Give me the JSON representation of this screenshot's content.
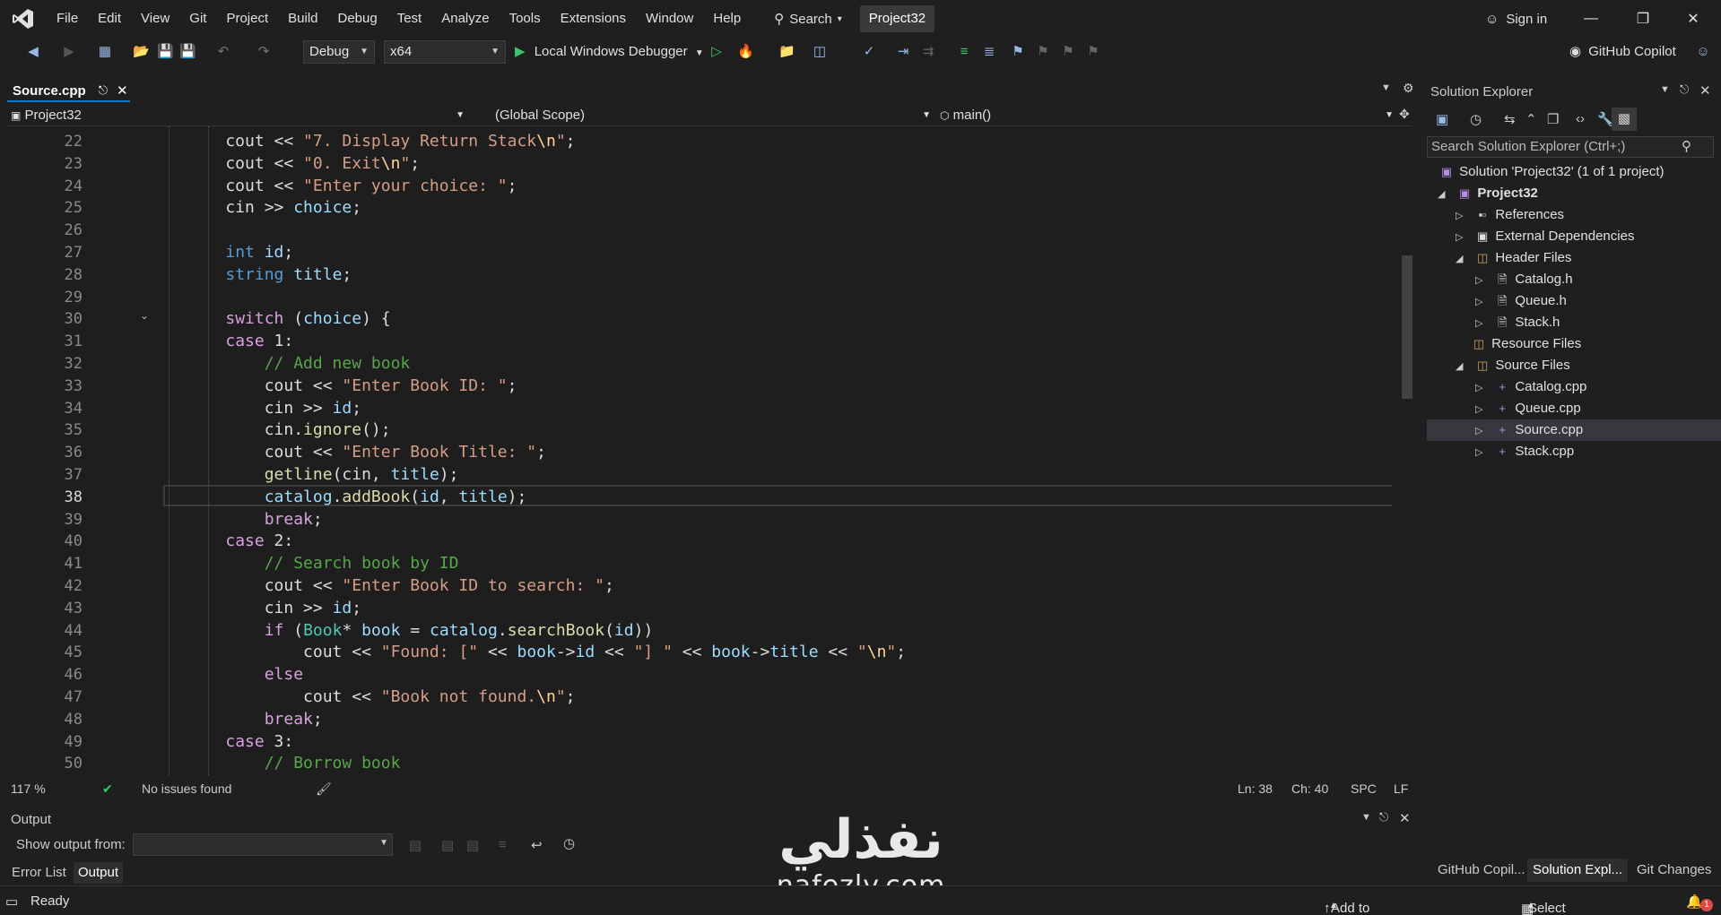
{
  "menu": {
    "items": [
      "File",
      "Edit",
      "View",
      "Git",
      "Project",
      "Build",
      "Debug",
      "Test",
      "Analyze",
      "Tools",
      "Extensions",
      "Window",
      "Help"
    ],
    "search_label": "Search",
    "project_badge": "Project32",
    "signin_label": "Sign in"
  },
  "toolbar": {
    "config": "Debug",
    "platform": "x64",
    "debugger": "Local Windows Debugger",
    "copilot_label": "GitHub Copilot"
  },
  "tab": {
    "active_label": "Source.cpp"
  },
  "navbar": {
    "project": "Project32",
    "scope": "(Global Scope)",
    "member": "main()"
  },
  "editor": {
    "current_line": 38,
    "lines": [
      {
        "n": "22",
        "code": "    cout << \"7. Display Return Stack\\n\";"
      },
      {
        "n": "23",
        "code": "    cout << \"0. Exit\\n\";"
      },
      {
        "n": "24",
        "code": "    cout << \"Enter your choice: \";"
      },
      {
        "n": "25",
        "code": "    cin >> choice;"
      },
      {
        "n": "26",
        "code": ""
      },
      {
        "n": "27",
        "code": "    int id;"
      },
      {
        "n": "28",
        "code": "    string title;"
      },
      {
        "n": "29",
        "code": ""
      },
      {
        "n": "30",
        "code": "    switch (choice) {"
      },
      {
        "n": "31",
        "code": "    case 1:"
      },
      {
        "n": "32",
        "code": "        // Add new book"
      },
      {
        "n": "33",
        "code": "        cout << \"Enter Book ID: \";"
      },
      {
        "n": "34",
        "code": "        cin >> id;"
      },
      {
        "n": "35",
        "code": "        cin.ignore();"
      },
      {
        "n": "36",
        "code": "        cout << \"Enter Book Title: \";"
      },
      {
        "n": "37",
        "code": "        getline(cin, title);"
      },
      {
        "n": "38",
        "code": "        catalog.addBook(id, title);"
      },
      {
        "n": "39",
        "code": "        break;"
      },
      {
        "n": "40",
        "code": "    case 2:"
      },
      {
        "n": "41",
        "code": "        // Search book by ID"
      },
      {
        "n": "42",
        "code": "        cout << \"Enter Book ID to search: \";"
      },
      {
        "n": "43",
        "code": "        cin >> id;"
      },
      {
        "n": "44",
        "code": "        if (Book* book = catalog.searchBook(id))"
      },
      {
        "n": "45",
        "code": "            cout << \"Found: [\" << book->id << \"] \" << book->title << \"\\n\";"
      },
      {
        "n": "46",
        "code": "        else"
      },
      {
        "n": "47",
        "code": "            cout << \"Book not found.\\n\";"
      },
      {
        "n": "48",
        "code": "        break;"
      },
      {
        "n": "49",
        "code": "    case 3:"
      },
      {
        "n": "50",
        "code": "        // Borrow book"
      }
    ]
  },
  "editor_status": {
    "zoom": "117 %",
    "issues": "No issues found",
    "line": "Ln: 38",
    "col": "Ch: 40",
    "spacing": "SPC",
    "eol": "LF"
  },
  "output": {
    "title": "Output",
    "show_from_label": "Show output from:",
    "tabs": [
      "Error List",
      "Output"
    ]
  },
  "solution_explorer": {
    "title": "Solution Explorer",
    "search_placeholder": "Search Solution Explorer (Ctrl+;)",
    "tree": [
      {
        "label": "Solution 'Project32' (1 of 1 project)",
        "icon": "solution-icon"
      },
      {
        "label": "Project32",
        "icon": "project-icon"
      },
      {
        "label": "References",
        "icon": "references-icon"
      },
      {
        "label": "External Dependencies",
        "icon": "external-deps-icon"
      },
      {
        "label": "Header Files",
        "icon": "folder-icon"
      },
      {
        "label": "Catalog.h",
        "icon": "header-file-icon"
      },
      {
        "label": "Queue.h",
        "icon": "header-file-icon"
      },
      {
        "label": "Stack.h",
        "icon": "header-file-icon"
      },
      {
        "label": "Resource Files",
        "icon": "folder-icon"
      },
      {
        "label": "Source Files",
        "icon": "folder-icon"
      },
      {
        "label": "Catalog.cpp",
        "icon": "cpp-file-icon"
      },
      {
        "label": "Queue.cpp",
        "icon": "cpp-file-icon"
      },
      {
        "label": "Source.cpp",
        "icon": "cpp-file-icon"
      },
      {
        "label": "Stack.cpp",
        "icon": "cpp-file-icon"
      }
    ],
    "bottom_tabs": [
      "GitHub Copil...",
      "Solution Expl...",
      "Git Changes"
    ]
  },
  "statusbar": {
    "ready": "Ready",
    "add_source_control": "Add to Source Control",
    "select_repository": "Select Repository",
    "notification_count": "1"
  },
  "watermark": {
    "arabic": "نفذلي",
    "latin": "nafezly.com"
  }
}
